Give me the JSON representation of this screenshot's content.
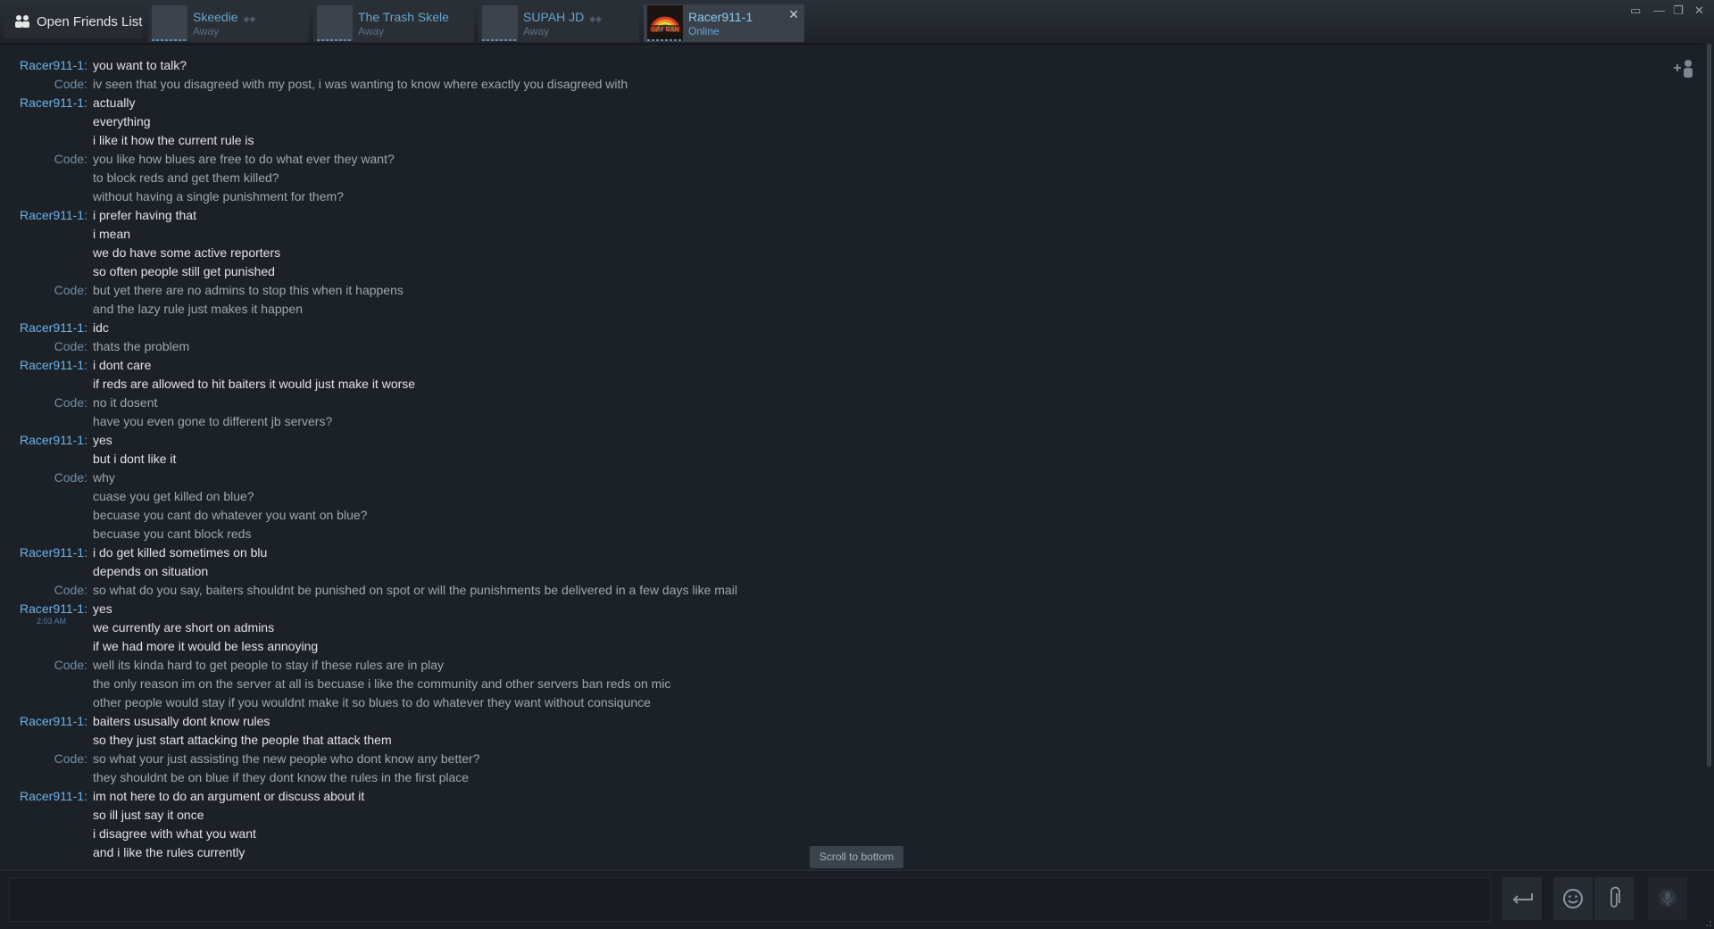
{
  "friends_button": {
    "label": "Open Friends List",
    "icon": "friends-icon"
  },
  "tabs": [
    {
      "name": "Skeedie",
      "status": "Away",
      "active": false
    },
    {
      "name": "The Trash Skele",
      "status": "Away",
      "active": false
    },
    {
      "name": "SUPAH JD",
      "status": "Away",
      "active": false
    },
    {
      "name": "Racer911-1",
      "status": "Online",
      "active": true,
      "avatar_text": "GAY BAN"
    }
  ],
  "window_controls": [
    "restore-icon",
    "minimize-icon",
    "maximize-icon",
    "close-icon"
  ],
  "messages": [
    {
      "speaker": "Racer911-1:",
      "text": "you want to talk?"
    },
    {
      "speaker": "Code:",
      "text": "iv seen that you disagreed with my post, i was wanting to know where exactly you disagreed with"
    },
    {
      "speaker": "Racer911-1:",
      "text": "actually"
    },
    {
      "speaker": "",
      "text": "everything"
    },
    {
      "speaker": "",
      "text": "i like it how the current rule is"
    },
    {
      "speaker": "Code:",
      "text": "you like how blues are free to do what ever they want?"
    },
    {
      "speaker": "",
      "text": "to block reds and get them killed?"
    },
    {
      "speaker": "",
      "text": "without having a single punishment for them?"
    },
    {
      "speaker": "Racer911-1:",
      "text": "i prefer having that"
    },
    {
      "speaker": "",
      "text": "i mean"
    },
    {
      "speaker": "",
      "text": "we do have some active reporters"
    },
    {
      "speaker": "",
      "text": "so often people still get punished"
    },
    {
      "speaker": "Code:",
      "text": "but yet there are no admins to stop this when it happens"
    },
    {
      "speaker": "",
      "text": "and the lazy rule just makes it happen"
    },
    {
      "speaker": "Racer911-1:",
      "text": "idc"
    },
    {
      "speaker": "Code:",
      "text": "thats the problem"
    },
    {
      "speaker": "Racer911-1:",
      "text": "i dont care"
    },
    {
      "speaker": "",
      "text": "if reds are allowed to hit baiters it would just make it worse"
    },
    {
      "speaker": "Code:",
      "text": "no it dosent"
    },
    {
      "speaker": "",
      "text": "have you even gone to different jb servers?"
    },
    {
      "speaker": "Racer911-1:",
      "text": "yes"
    },
    {
      "speaker": "",
      "text": "but i dont like it"
    },
    {
      "speaker": "Code:",
      "text": "why"
    },
    {
      "speaker": "",
      "text": "cuase you get killed on blue?"
    },
    {
      "speaker": "",
      "text": "becuase you cant do whatever you want on blue?"
    },
    {
      "speaker": "",
      "text": "becuase you cant block reds"
    },
    {
      "speaker": "Racer911-1:",
      "text": "i do get killed sometimes on blu"
    },
    {
      "speaker": "",
      "text": "depends on situation"
    },
    {
      "speaker": "Code:",
      "text": "so what do you say, baiters shouldnt be punished on spot or will the punishments be delivered in a few days like mail"
    },
    {
      "speaker": "Racer911-1:",
      "text": "yes",
      "timestamp": "2:03 AM"
    },
    {
      "speaker": "",
      "text": "we currently are short on admins"
    },
    {
      "speaker": "",
      "text": "if we had more it would be less annoying"
    },
    {
      "speaker": "Code:",
      "text": "well its kinda hard to get people to stay if these rules are in play"
    },
    {
      "speaker": "",
      "text": "the only reason im on the server at all is becuase i like the community and other servers ban reds on mic"
    },
    {
      "speaker": "",
      "text": "other people would stay if you wouldnt make it so blues to do whatever they want without consiqunce"
    },
    {
      "speaker": "Racer911-1:",
      "text": "baiters ususally dont know rules"
    },
    {
      "speaker": "",
      "text": "so they just start attacking the people that attack them"
    },
    {
      "speaker": "Code:",
      "text": "so what your just assisting the new people who dont know any better?"
    },
    {
      "speaker": "",
      "text": "they shouldnt be on blue if they dont know the rules in the first place"
    },
    {
      "speaker": "Racer911-1:",
      "text": "im not here to do an argument or discuss about it"
    },
    {
      "speaker": "",
      "text": "so ill just say it once"
    },
    {
      "speaker": "",
      "text": "i disagree with what you want"
    },
    {
      "speaker": "",
      "text": "and i like the rules currently"
    }
  ],
  "speaker_ids": {
    "Racer911-1:": "r",
    "Code:": "c"
  },
  "scroll_to_bottom": "Scroll to bottom",
  "input": {
    "value": "",
    "placeholder": ""
  },
  "input_buttons": [
    "send-icon",
    "emoticon-icon",
    "attach-icon",
    "voice-icon"
  ],
  "colors": {
    "background": "#1c2128",
    "friend_name": "#6cb2e8",
    "self_name": "#6f8ea5",
    "friend_text": "#e1e4e7",
    "self_text": "#9fa7ae",
    "online_tab": "#8bcbf0"
  }
}
